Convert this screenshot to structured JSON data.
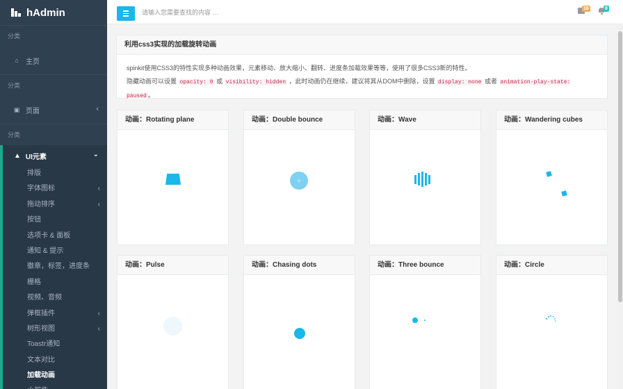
{
  "brand": {
    "name": "hAdmin"
  },
  "sidebar": {
    "cat1": "分类",
    "home": "主页",
    "cat2": "分类",
    "pages": "页面",
    "cat3": "分类",
    "ui": "UI元素",
    "items": [
      {
        "label": "排版",
        "chevron": false
      },
      {
        "label": "字体图标",
        "chevron": true
      },
      {
        "label": "拖动排序",
        "chevron": true
      },
      {
        "label": "按钮",
        "chevron": false
      },
      {
        "label": "选项卡 & 面板",
        "chevron": false
      },
      {
        "label": "通知 & 提示",
        "chevron": false
      },
      {
        "label": "徽章，标签，进度条",
        "chevron": false
      },
      {
        "label": "栅格",
        "chevron": false
      },
      {
        "label": "视频、音频",
        "chevron": false
      },
      {
        "label": "弹框插件",
        "chevron": true
      },
      {
        "label": "树形视图",
        "chevron": true
      },
      {
        "label": "Toastr通知",
        "chevron": false
      },
      {
        "label": "文本对比",
        "chevron": false
      },
      {
        "label": "加载动画",
        "chevron": false,
        "current": true
      },
      {
        "label": "小部件",
        "chevron": false
      }
    ]
  },
  "topbar": {
    "search_placeholder": "请输入您需要查找的内容 …",
    "mail_count": "16",
    "alert_count": "8"
  },
  "intro": {
    "title": "利用css3实现的加载旋转动画",
    "line1": "spinkit使用CSS3的特性实现多种动画效果，元素移动、放大缩小、翻转、进度条加载效果等等，使用了很多CSS3新的特性。",
    "line2_a": "隐藏动画可以设置",
    "code1": "opacity: 0",
    "or1": "或",
    "code2": "visibility: hidden",
    "line2_b": "，此时动画仍在继续，建议将其从DOM中删除，设置",
    "code3": "display: none",
    "or2": "或者",
    "code4": "animation-play-state: paused",
    "end": "。"
  },
  "cards": [
    {
      "title": "动画：Rotating plane"
    },
    {
      "title": "动画：Double bounce"
    },
    {
      "title": "动画：Wave"
    },
    {
      "title": "动画：Wandering cubes"
    },
    {
      "title": "动画：Pulse"
    },
    {
      "title": "动画：Chasing dots"
    },
    {
      "title": "动画：Three bounce"
    },
    {
      "title": "动画：Circle"
    }
  ],
  "colors": {
    "accent": "#1ab7ea",
    "sidebar": "#2f4050",
    "active_border": "#19aa8d"
  }
}
